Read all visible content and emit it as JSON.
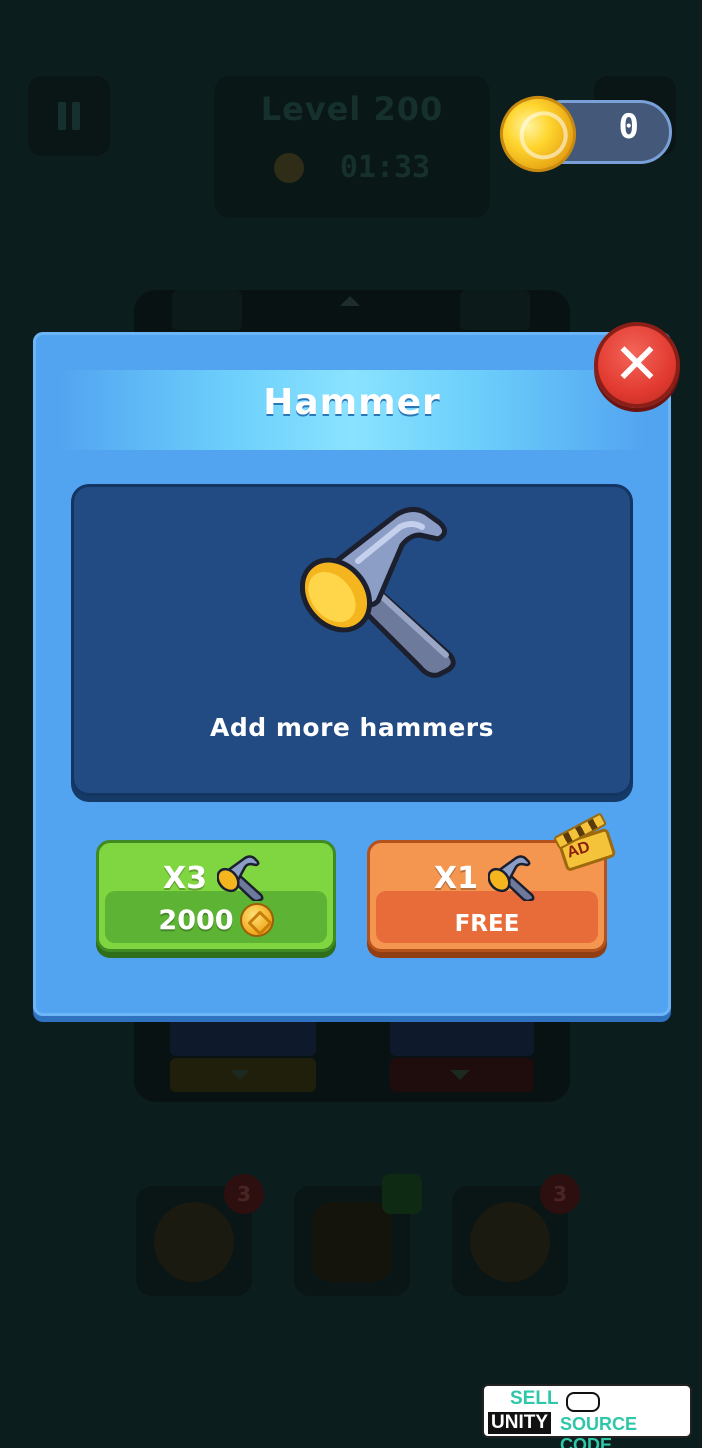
{
  "hud": {
    "level_label": "Level 200",
    "timer": "01:33",
    "coins": "0"
  },
  "dialog": {
    "title": "Hammer",
    "description": "Add more hammers",
    "close_symbol": "✕"
  },
  "offers": [
    {
      "quantity": "X3",
      "price": "2000",
      "currency": "coin",
      "color": "#7fd641"
    },
    {
      "quantity": "X1",
      "price": "FREE",
      "badge": "AD",
      "color": "#f49550"
    }
  ],
  "boosters": [
    {
      "icon": "clock-booster-icon",
      "count": "3"
    },
    {
      "icon": "hammer-booster-icon",
      "count": ""
    },
    {
      "icon": "magic-wand-booster-icon",
      "count": "3"
    }
  ],
  "watermark": {
    "line1": "SELL",
    "line2a": "UNITY",
    "line2b": "SOURCE CODE"
  }
}
